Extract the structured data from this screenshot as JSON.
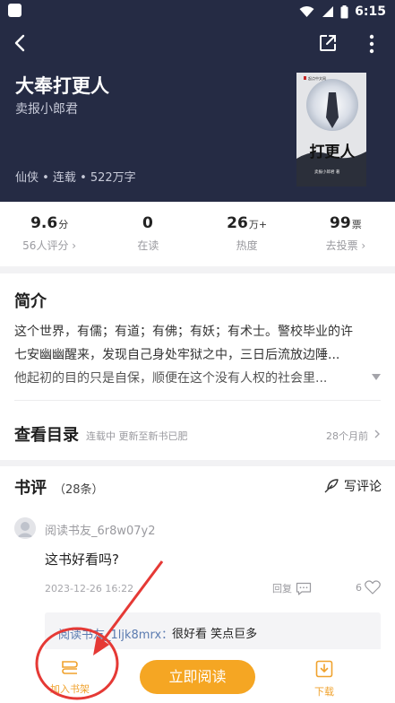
{
  "status_bar": {
    "time": "6:15"
  },
  "book": {
    "title": "大奉打更人",
    "author": "卖报小郎君",
    "meta": "仙侠 • 连载 • 522万字",
    "cover_brand": "起点中文网",
    "cover_title": "打更人",
    "cover_author": "卖报小郎君 著"
  },
  "stats": [
    {
      "value": "9.6",
      "unit": "分",
      "label": "56人评分 ›"
    },
    {
      "value": "0",
      "unit": "",
      "label": "在读"
    },
    {
      "value": "26",
      "unit": "万+",
      "label": "热度"
    },
    {
      "value": "99",
      "unit": "票",
      "label": "去投票 ›"
    }
  ],
  "intro": {
    "title": "简介",
    "lines": [
      "这个世界，有儒；有道；有佛；有妖；有术士。警校毕业的许",
      "七安幽幽醒来，发现自己身处牢狱之中，三日后流放边陲...",
      "他起初的目的只是自保，顺便在这个没有人权的社会里..."
    ]
  },
  "catalog": {
    "title": "查看目录",
    "status": "连载中 更新至新书已肥",
    "updated": "28个月前"
  },
  "reviews": {
    "title": "书评",
    "count": "（28条）",
    "write_label": "写评论",
    "items": [
      {
        "user": "阅读书友_6r8w07y2",
        "text": "这书好看吗?",
        "date": "2023-12-26 16:22",
        "reply_label": "回复",
        "likes": "6",
        "reply": {
          "user": "阅读书友_1ljk8mrx：",
          "text": "很好看 笑点巨多"
        }
      }
    ]
  },
  "bottom_bar": {
    "add_shelf": "加入书架",
    "read_now": "立即阅读",
    "download": "下载"
  },
  "colors": {
    "header_bg": "#252b44",
    "accent": "#f5a623",
    "annotation": "#e53935"
  }
}
